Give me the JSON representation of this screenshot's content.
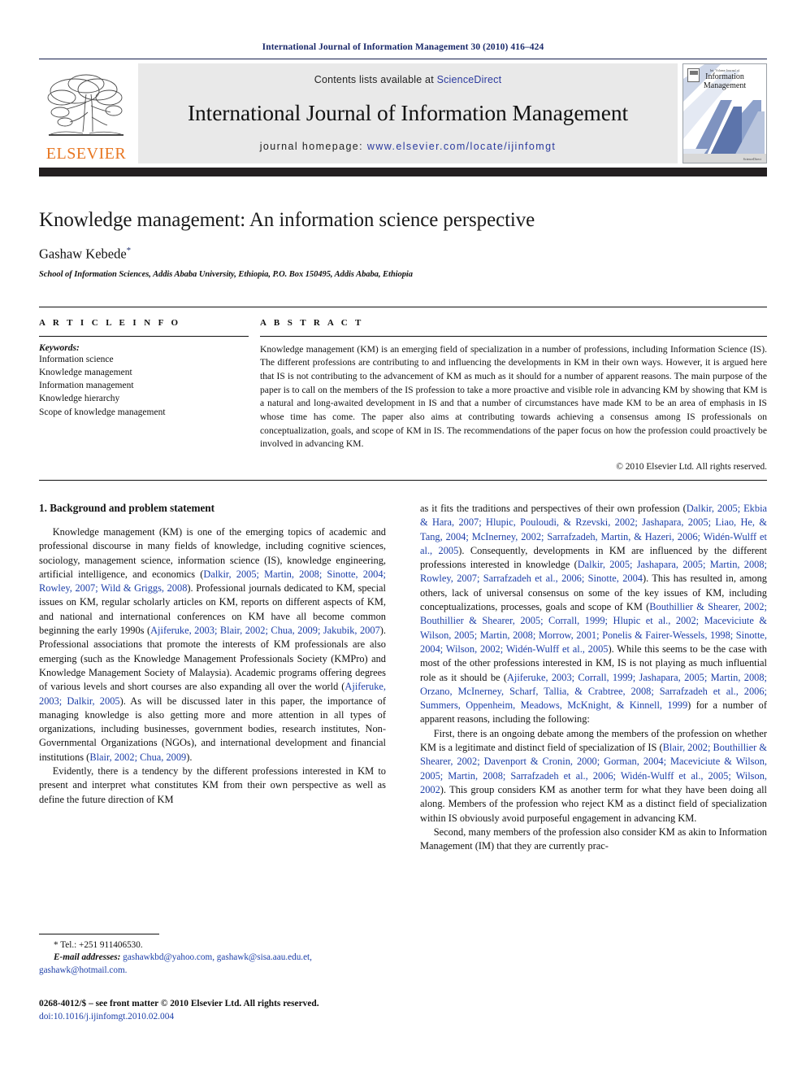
{
  "running_head": "International Journal of Information Management 30 (2010) 416–424",
  "masthead": {
    "publisher_wordmark": "ELSEVIER",
    "contents_prefix": "Contents lists available at",
    "contents_link": "ScienceDirect",
    "journal_title": "International Journal of Information Management",
    "homepage_prefix": "journal homepage:",
    "homepage_url": "www.elsevier.com/locate/ijinfomgt",
    "cover": {
      "kicker": "Int. Volume Journal of",
      "title_line1": "Information",
      "title_line2": "Management",
      "footer_label": "ScienceDirect"
    },
    "colors": {
      "elsevier_orange": "#e87722",
      "link_blue": "#2b3a9e",
      "banner_gray": "#e9e9e9",
      "bar_black": "#231f20"
    }
  },
  "article": {
    "title": "Knowledge management: An information science perspective",
    "author": "Gashaw Kebede",
    "author_marker": "*",
    "affiliation": "School of Information Sciences, Addis Ababa University, Ethiopia, P.O. Box 150495, Addis Ababa, Ethiopia"
  },
  "article_info": {
    "label": "A R T I C L E   I N F O",
    "keywords_label": "Keywords:",
    "keywords": [
      "Information science",
      "Knowledge management",
      "Information management",
      "Knowledge hierarchy",
      "Scope of knowledge management"
    ]
  },
  "abstract": {
    "label": "A B S T R A C T",
    "text": "Knowledge management (KM) is an emerging field of specialization in a number of professions, including Information Science (IS). The different professions are contributing to and influencing the developments in KM in their own ways. However, it is argued here that IS is not contributing to the advancement of KM as much as it should for a number of apparent reasons. The main purpose of the paper is to call on the members of the IS profession to take a more proactive and visible role in advancing KM by showing that KM is a natural and long-awaited development in IS and that a number of circumstances have made KM to be an area of emphasis in IS whose time has come. The paper also aims at contributing towards achieving a consensus among IS professionals on conceptualization, goals, and scope of KM in IS. The recommendations of the paper focus on how the profession could proactively be involved in advancing KM.",
    "copyright": "© 2010 Elsevier Ltd. All rights reserved."
  },
  "body": {
    "section_heading": "1. Background and problem statement",
    "left_paragraphs": [
      {
        "runs": [
          {
            "t": "Knowledge management (KM) is one of the emerging topics of academic and professional discourse in many fields of knowledge, including cognitive sciences, sociology, management science, information science (IS), knowledge engineering, artificial intelligence, and economics ("
          },
          {
            "t": "Dalkir, 2005; Martin, 2008; Sinotte, 2004; Rowley, 2007; Wild & Griggs, 2008",
            "cite": true
          },
          {
            "t": "). Professional journals dedicated to KM, special issues on KM, regular scholarly articles on KM, reports on different aspects of KM, and national and international conferences on KM have all become common beginning the early 1990s ("
          },
          {
            "t": "Ajiferuke, 2003; Blair, 2002; Chua, 2009; Jakubik, 2007",
            "cite": true
          },
          {
            "t": "). Professional associations that promote the interests of KM professionals are also emerging (such as the Knowledge Management Professionals Society (KMPro) and Knowledge Management Society of Malaysia). Academic programs offering degrees of various levels and short courses are also expanding all over the world ("
          },
          {
            "t": "Ajiferuke, 2003; Dalkir, 2005",
            "cite": true
          },
          {
            "t": "). As will be discussed later in this paper, the importance of managing knowledge is also getting more and more attention in all types of organizations, including businesses, government bodies, research institutes, Non-Governmental Organizations (NGOs), and international development and financial institutions ("
          },
          {
            "t": "Blair, 2002; Chua, 2009",
            "cite": true
          },
          {
            "t": ")."
          }
        ]
      },
      {
        "runs": [
          {
            "t": "Evidently, there is a tendency by the different professions interested in KM to present and interpret what constitutes KM from their own perspective as well as define the future direction of KM"
          }
        ]
      }
    ],
    "right_paragraphs": [
      {
        "continuation": true,
        "runs": [
          {
            "t": "as it fits the traditions and perspectives of their own profession ("
          },
          {
            "t": "Dalkir, 2005; Ekbia & Hara, 2007; Hlupic, Pouloudi, & Rzevski, 2002; Jashapara, 2005; Liao, He, & Tang, 2004; McInerney, 2002; Sarrafzadeh, Martin, & Hazeri, 2006; Widén-Wulff et al., 2005",
            "cite": true
          },
          {
            "t": "). Consequently, developments in KM are influenced by the different professions interested in knowledge ("
          },
          {
            "t": "Dalkir, 2005; Jashapara, 2005; Martin, 2008; Rowley, 2007; Sarrafzadeh et al., 2006; Sinotte, 2004",
            "cite": true
          },
          {
            "t": "). This has resulted in, among others, lack of universal consensus on some of the key issues of KM, including conceptualizations, processes, goals and scope of KM ("
          },
          {
            "t": "Bouthillier & Shearer, 2002; Bouthillier & Shearer, 2005; Corrall, 1999; Hlupic et al., 2002; Maceviciute & Wilson, 2005; Martin, 2008; Morrow, 2001; Ponelis & Fairer-Wessels, 1998; Sinotte, 2004; Wilson, 2002; Widén-Wulff et al., 2005",
            "cite": true
          },
          {
            "t": "). While this seems to be the case with most of the other professions interested in KM, IS is not playing as much influential role as it should be ("
          },
          {
            "t": "Ajiferuke, 2003; Corrall, 1999; Jashapara, 2005; Martin, 2008; Orzano, McInerney, Scharf, Tallia, & Crabtree, 2008; Sarrafzadeh et al., 2006; Summers, Oppenheim, Meadows, McKnight, & Kinnell, 1999",
            "cite": true
          },
          {
            "t": ") for a number of apparent reasons, including the following:"
          }
        ]
      },
      {
        "runs": [
          {
            "t": "First, there is an ongoing debate among the members of the profession on whether KM is a legitimate and distinct field of specialization of IS ("
          },
          {
            "t": "Blair, 2002; Bouthillier & Shearer, 2002; Davenport & Cronin, 2000; Gorman, 2004; Maceviciute & Wilson, 2005; Martin, 2008; Sarrafzadeh et al., 2006; Widén-Wulff et al., 2005; Wilson, 2002",
            "cite": true
          },
          {
            "t": "). This group considers KM as another term for what they have been doing all along. Members of the profession who reject KM as a distinct field of specialization within IS obviously avoid purposeful engagement in advancing KM."
          }
        ]
      },
      {
        "runs": [
          {
            "t": "Second, many members of the profession also consider KM as akin to Information Management (IM) that they are currently prac-"
          }
        ]
      }
    ]
  },
  "footnotes": {
    "tel_marker": "*",
    "tel": "Tel.: +251 911406530.",
    "email_label": "E-mail addresses:",
    "emails": "gashawkbd@yahoo.com, gashawk@sisa.aau.edu.et, gashawk@hotmail.com.",
    "issn_line": "0268-4012/$ – see front matter © 2010 Elsevier Ltd. All rights reserved.",
    "doi_line": "doi:10.1016/j.ijinfomgt.2010.02.004"
  }
}
